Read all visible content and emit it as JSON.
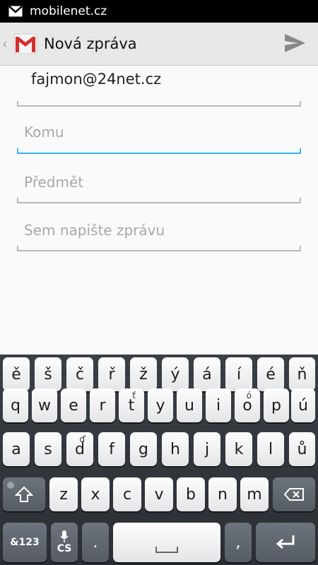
{
  "status_bar": {
    "text": "mobilenet.cz",
    "notification_icon": "gmail-envelope-icon"
  },
  "action_bar": {
    "title": "Nová zpráva",
    "app_icon": "gmail-icon",
    "send_icon": "send-icon"
  },
  "form": {
    "from": "fajmon@24net.cz",
    "to_placeholder": "Komu",
    "subject_placeholder": "Předmět",
    "body_placeholder": "Sem napište zprávu"
  },
  "colors": {
    "accent": "#33b5e5",
    "keyboard_bg": "#33383e"
  },
  "keyboard": {
    "row1": [
      "ě",
      "š",
      "č",
      "ř",
      "ž",
      "ý",
      "á",
      "í",
      "é",
      "ň"
    ],
    "row2": [
      {
        "label": "q"
      },
      {
        "label": "w"
      },
      {
        "label": "e"
      },
      {
        "label": "r"
      },
      {
        "label": "t",
        "sup": "ť"
      },
      {
        "label": "y"
      },
      {
        "label": "u"
      },
      {
        "label": "i"
      },
      {
        "label": "o",
        "sup": "ó"
      },
      {
        "label": "p"
      },
      {
        "label": "ú"
      }
    ],
    "row3": [
      {
        "label": "a"
      },
      {
        "label": "s"
      },
      {
        "label": "d",
        "sup": "ď"
      },
      {
        "label": "f"
      },
      {
        "label": "g"
      },
      {
        "label": "h"
      },
      {
        "label": "j"
      },
      {
        "label": "k"
      },
      {
        "label": "l"
      },
      {
        "label": "ů"
      }
    ],
    "row4": [
      "z",
      "x",
      "c",
      "v",
      "b",
      "n",
      "m"
    ],
    "symbols_label": "&123",
    "language_label": "CS",
    "period_label": ".",
    "comma_label": ","
  }
}
